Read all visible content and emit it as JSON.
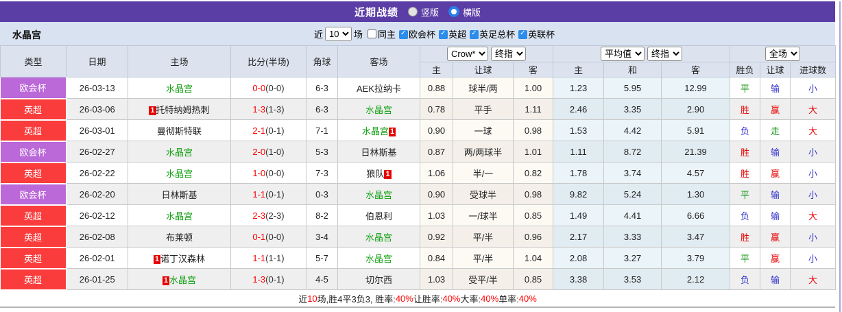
{
  "title_bar": {
    "title": "近期战绩",
    "radio_vertical": "竖版",
    "radio_horizontal": "横版",
    "selected": "横版"
  },
  "filter_bar": {
    "team": "水晶宫",
    "recent_label": "近",
    "recent_value": "10",
    "games_label": "场",
    "same_home_label": "同主",
    "same_home_checked": false,
    "leagues": [
      "欧会杯",
      "英超",
      "英足总杯",
      "英联杯"
    ]
  },
  "table": {
    "headers": {
      "type": "类型",
      "date": "日期",
      "home": "主场",
      "score": "比分(半场)",
      "corner": "角球",
      "away": "客场",
      "odds_sub": [
        "主",
        "让球",
        "客"
      ],
      "avg_sub": [
        "主",
        "和",
        "客"
      ],
      "result_sub": [
        "胜负",
        "让球",
        "进球数"
      ]
    },
    "dropdowns": {
      "odds_source": "Crow*",
      "odds_time": "终指",
      "avg_source": "平均值",
      "avg_time": "终指",
      "result_scope": "全场"
    },
    "rows": [
      {
        "league": "欧会杯",
        "league_color": "purple",
        "date": "26-03-13",
        "home": {
          "name": "水晶宫",
          "highlight": true
        },
        "score": {
          "ft": "0-0",
          "ht": "(0-0)"
        },
        "corner": "6-3",
        "away": {
          "name": "AEK拉纳卡",
          "highlight": false
        },
        "odds": [
          "0.88",
          "球半/两",
          "1.00"
        ],
        "avg": [
          "1.23",
          "5.95",
          "12.99"
        ],
        "results": [
          {
            "text": "平",
            "color": "g"
          },
          {
            "text": "输",
            "color": "b"
          },
          {
            "text": "小",
            "color": "b"
          }
        ]
      },
      {
        "league": "英超",
        "league_color": "red",
        "date": "26-03-06",
        "home": {
          "name": "托特纳姆热刺",
          "highlight": false,
          "badge": "1",
          "badge_pos": "prefix"
        },
        "score": {
          "ft": "1-3",
          "ht": "(1-3)"
        },
        "corner": "6-3",
        "away": {
          "name": "水晶宫",
          "highlight": true
        },
        "odds": [
          "0.78",
          "平手",
          "1.11"
        ],
        "avg": [
          "2.46",
          "3.35",
          "2.90"
        ],
        "results": [
          {
            "text": "胜",
            "color": "r"
          },
          {
            "text": "赢",
            "color": "r"
          },
          {
            "text": "大",
            "color": "r"
          }
        ]
      },
      {
        "league": "英超",
        "league_color": "red",
        "date": "26-03-01",
        "home": {
          "name": "曼彻斯特联",
          "highlight": false
        },
        "score": {
          "ft": "2-1",
          "ht": "(0-1)"
        },
        "corner": "7-1",
        "away": {
          "name": "水晶宫",
          "highlight": true,
          "badge": "1",
          "badge_pos": "suffix"
        },
        "odds": [
          "0.90",
          "一球",
          "0.98"
        ],
        "avg": [
          "1.53",
          "4.42",
          "5.91"
        ],
        "results": [
          {
            "text": "负",
            "color": "b"
          },
          {
            "text": "走",
            "color": "g"
          },
          {
            "text": "大",
            "color": "r"
          }
        ]
      },
      {
        "league": "欧会杯",
        "league_color": "purple",
        "date": "26-02-27",
        "home": {
          "name": "水晶宫",
          "highlight": true
        },
        "score": {
          "ft": "2-0",
          "ht": "(1-0)"
        },
        "corner": "5-3",
        "away": {
          "name": "日林斯基",
          "highlight": false
        },
        "odds": [
          "0.87",
          "两/两球半",
          "1.01"
        ],
        "avg": [
          "1.11",
          "8.72",
          "21.39"
        ],
        "results": [
          {
            "text": "胜",
            "color": "r"
          },
          {
            "text": "输",
            "color": "b"
          },
          {
            "text": "小",
            "color": "b"
          }
        ]
      },
      {
        "league": "英超",
        "league_color": "red",
        "date": "26-02-22",
        "home": {
          "name": "水晶宫",
          "highlight": true
        },
        "score": {
          "ft": "1-0",
          "ht": "(0-0)"
        },
        "corner": "7-3",
        "away": {
          "name": "狼队",
          "highlight": false,
          "badge": "1",
          "badge_pos": "suffix"
        },
        "odds": [
          "1.06",
          "半/一",
          "0.82"
        ],
        "avg": [
          "1.78",
          "3.74",
          "4.57"
        ],
        "results": [
          {
            "text": "胜",
            "color": "r"
          },
          {
            "text": "赢",
            "color": "r"
          },
          {
            "text": "小",
            "color": "b"
          }
        ]
      },
      {
        "league": "欧会杯",
        "league_color": "purple",
        "date": "26-02-20",
        "home": {
          "name": "日林斯基",
          "highlight": false
        },
        "score": {
          "ft": "1-1",
          "ht": "(0-1)"
        },
        "corner": "0-3",
        "away": {
          "name": "水晶宫",
          "highlight": true
        },
        "odds": [
          "0.90",
          "受球半",
          "0.98"
        ],
        "avg": [
          "9.82",
          "5.24",
          "1.30"
        ],
        "results": [
          {
            "text": "平",
            "color": "g"
          },
          {
            "text": "输",
            "color": "b"
          },
          {
            "text": "小",
            "color": "b"
          }
        ]
      },
      {
        "league": "英超",
        "league_color": "red",
        "date": "26-02-12",
        "home": {
          "name": "水晶宫",
          "highlight": true
        },
        "score": {
          "ft": "2-3",
          "ht": "(2-3)"
        },
        "corner": "8-2",
        "away": {
          "name": "伯恩利",
          "highlight": false
        },
        "odds": [
          "1.03",
          "一/球半",
          "0.85"
        ],
        "avg": [
          "1.49",
          "4.41",
          "6.66"
        ],
        "results": [
          {
            "text": "负",
            "color": "b"
          },
          {
            "text": "输",
            "color": "b"
          },
          {
            "text": "大",
            "color": "r"
          }
        ]
      },
      {
        "league": "英超",
        "league_color": "red",
        "date": "26-02-08",
        "home": {
          "name": "布莱顿",
          "highlight": false
        },
        "score": {
          "ft": "0-1",
          "ht": "(0-0)"
        },
        "corner": "3-4",
        "away": {
          "name": "水晶宫",
          "highlight": true
        },
        "odds": [
          "0.92",
          "平/半",
          "0.96"
        ],
        "avg": [
          "2.17",
          "3.33",
          "3.47"
        ],
        "results": [
          {
            "text": "胜",
            "color": "r"
          },
          {
            "text": "赢",
            "color": "r"
          },
          {
            "text": "小",
            "color": "b"
          }
        ]
      },
      {
        "league": "英超",
        "league_color": "red",
        "date": "26-02-01",
        "home": {
          "name": "诺丁汉森林",
          "highlight": false,
          "badge": "1",
          "badge_pos": "prefix"
        },
        "score": {
          "ft": "1-1",
          "ht": "(1-1)"
        },
        "corner": "5-7",
        "away": {
          "name": "水晶宫",
          "highlight": true
        },
        "odds": [
          "0.84",
          "平/半",
          "1.04"
        ],
        "avg": [
          "2.08",
          "3.27",
          "3.79"
        ],
        "results": [
          {
            "text": "平",
            "color": "g"
          },
          {
            "text": "赢",
            "color": "r"
          },
          {
            "text": "小",
            "color": "b"
          }
        ]
      },
      {
        "league": "英超",
        "league_color": "red",
        "date": "26-01-25",
        "home": {
          "name": "水晶宫",
          "highlight": true,
          "badge": "1",
          "badge_pos": "prefix"
        },
        "score": {
          "ft": "1-3",
          "ht": "(0-1)"
        },
        "corner": "4-5",
        "away": {
          "name": "切尔西",
          "highlight": false
        },
        "odds": [
          "1.03",
          "受平/半",
          "0.85"
        ],
        "avg": [
          "3.38",
          "3.53",
          "2.12"
        ],
        "results": [
          {
            "text": "负",
            "color": "b"
          },
          {
            "text": "输",
            "color": "b"
          },
          {
            "text": "大",
            "color": "r"
          }
        ]
      }
    ]
  },
  "footer": {
    "segments": [
      {
        "text": "近",
        "red": false
      },
      {
        "text": "10",
        "red": true
      },
      {
        "text": "场,胜4平3负3, 胜率:",
        "red": false
      },
      {
        "text": "40%",
        "red": true
      },
      {
        "text": " 让胜率:",
        "red": false
      },
      {
        "text": "40%",
        "red": true
      },
      {
        "text": " 大率:",
        "red": false
      },
      {
        "text": "40%",
        "red": true
      },
      {
        "text": " 单率:",
        "red": false
      },
      {
        "text": "40%",
        "red": true
      }
    ]
  },
  "colors": {
    "title_bar": "#5b3da6",
    "filter_bg": "#d9e2f0",
    "header_bg": "#dce3ee",
    "league_purple": "#bb68d9",
    "league_red": "#fb3c3c",
    "score_red": "#ff0000",
    "team_green": "#12a012",
    "result_red": "#e60000",
    "result_green": "#0a8f0a",
    "result_blue": "#3333cc",
    "checkbox_blue": "#2b8ceb"
  }
}
